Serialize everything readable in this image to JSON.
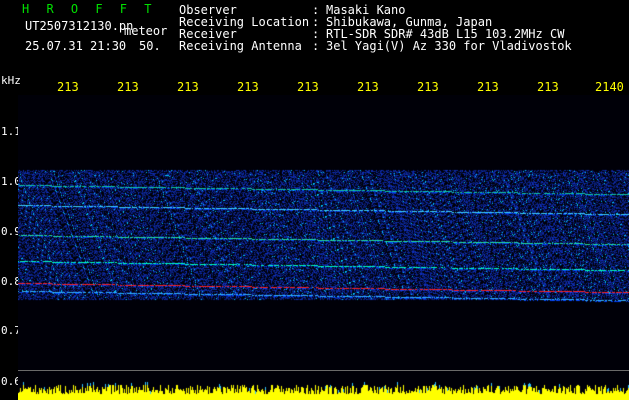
{
  "header": {
    "title": "H R O F F T",
    "file": "UT2507312130.pn",
    "type": "meteor",
    "datetime": "25.07.31 21:30",
    "count": "50."
  },
  "meta": [
    {
      "key": "Observer",
      "value": "Masaki Kano"
    },
    {
      "key": "Receiving Location",
      "value": "Shibukawa, Gunma, Japan"
    },
    {
      "key": "Receiver",
      "value": "RTL-SDR SDR# 43dB L15 103.2MHz CW"
    },
    {
      "key": "Receiving Antenna",
      "value": "3el Yagi(V) Az 330 for Vladivostok"
    }
  ],
  "axis": {
    "unit": "kHz",
    "time_ticks": [
      "213",
      "213",
      "213",
      "213",
      "213",
      "213",
      "213",
      "213",
      "213",
      "2140"
    ],
    "freq_ticks": [
      "1.1",
      "1.0",
      "0.9",
      "0.8",
      "0.7",
      "0.6"
    ]
  },
  "colors": {
    "background": "#000000",
    "header_text": "#ffffff",
    "title_text": "#00e000",
    "tick_text": "#ffff00",
    "signal_low": "#0a1ea0",
    "signal_mid": "#00c8ff",
    "signal_high": "#ff2020",
    "noise_floor": "#ffff00"
  }
}
